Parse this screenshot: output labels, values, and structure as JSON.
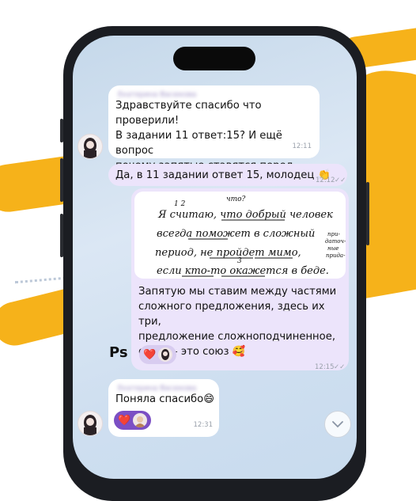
{
  "messages": [
    {
      "id": "m1",
      "sender": "Екатерина Васюкова",
      "text": "Здравствуйте спасибо что проверили!\nВ задании 11 ответ:15? И ещё вопрос\nпочему запятые ставятся перед\n«если» что это за правило?😊",
      "time": "12:11"
    },
    {
      "id": "m2",
      "text": "Да, в 11 задании ответ 15, молодец 👏",
      "time": "12:12",
      "status": "✓✓"
    },
    {
      "id": "m3",
      "image_lines": [
        "что?",
        "1  2",
        "Я считаю, что добрый человек",
        "всегда поможет в сложный",
        "период, не пройдет мимо,",
        "если кто-то окажется в беде.",
        "3",
        "при-",
        "даточ-",
        "ные",
        "прида-"
      ],
      "text": "Запятую мы ставим между частями\nсложного предложения, здесь их три,\nпредложение сложноподчиненное,\nесли — это союз 🥰",
      "time": "12:15",
      "status": "✓✓"
    },
    {
      "id": "m4",
      "sender": "Екатерина Васюкова",
      "text": "Поняла спасибо😄",
      "time": "12:31"
    }
  ],
  "reactions": {
    "heart": "❤️"
  },
  "overlay": {
    "ps_label": "Ps"
  }
}
